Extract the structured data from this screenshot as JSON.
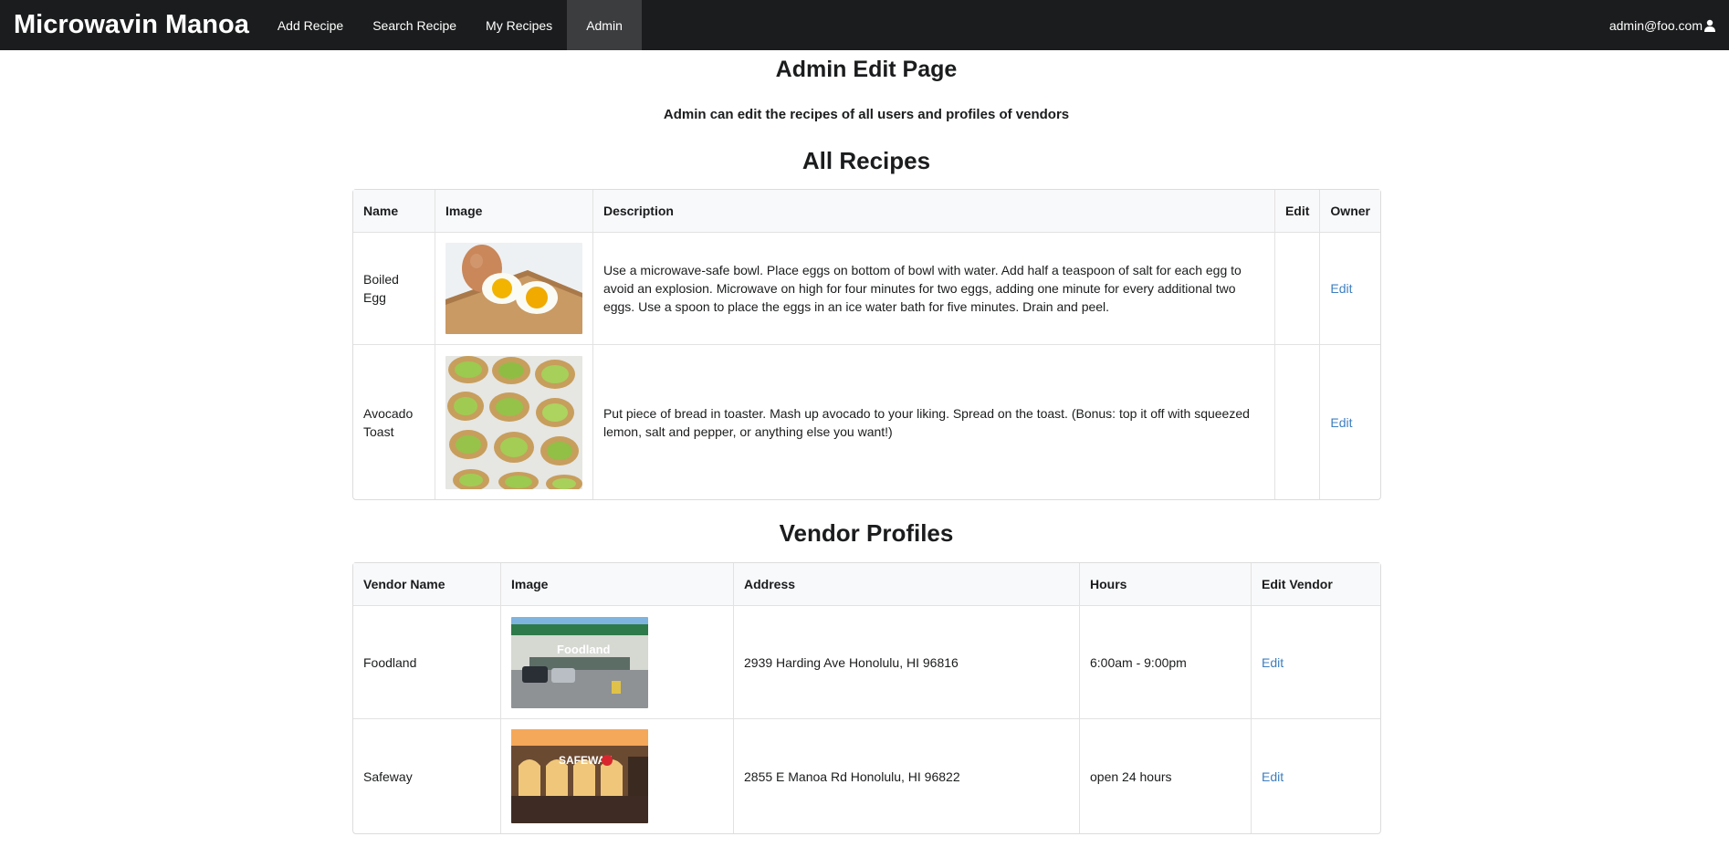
{
  "nav": {
    "brand": "Microwavin Manoa",
    "items": [
      {
        "label": "Add Recipe"
      },
      {
        "label": "Search Recipe"
      },
      {
        "label": "My Recipes"
      },
      {
        "label": "Admin"
      }
    ],
    "user": "admin@foo.com",
    "user_icon": "user-icon"
  },
  "page": {
    "title": "Admin Edit Page",
    "subtitle": "Admin can edit the recipes of all users and profiles of vendors"
  },
  "recipes": {
    "heading": "All Recipes",
    "columns": [
      "Name",
      "Image",
      "Description",
      "Edit",
      "Owner"
    ],
    "rows": [
      {
        "name": "Boiled Egg",
        "description": "Use a microwave-safe bowl. Place eggs on bottom of bowl with water. Add half a teaspoon of salt for each egg to avoid an explosion. Microwave on high for four minutes for two eggs, adding one minute for every additional two eggs. Use a spoon to place the eggs in an ice water bath for five minutes. Drain and peel.",
        "edit": "",
        "owner": "Edit"
      },
      {
        "name": "Avocado Toast",
        "description": "Put piece of bread in toaster. Mash up avocado to your liking. Spread on the toast. (Bonus: top it off with squeezed lemon, salt and pepper, or anything else you want!)",
        "edit": "",
        "owner": "Edit"
      }
    ]
  },
  "vendors": {
    "heading": "Vendor Profiles",
    "columns": [
      "Vendor Name",
      "Image",
      "Address",
      "Hours",
      "Edit Vendor"
    ],
    "rows": [
      {
        "name": "Foodland",
        "image_sign": "Foodland",
        "address": "2939 Harding Ave Honolulu, HI 96816",
        "hours": "6:00am - 9:00pm",
        "edit": "Edit"
      },
      {
        "name": "Safeway",
        "image_sign": "SAFEWAY",
        "address": "2855 E Manoa Rd Honolulu, HI 96822",
        "hours": "open 24 hours",
        "edit": "Edit"
      }
    ]
  },
  "colors": {
    "navbar": "#1b1c1d",
    "nav_active": "#3c3d3f",
    "link": "#3f7fbf",
    "header_bg": "#f8f9fa"
  }
}
